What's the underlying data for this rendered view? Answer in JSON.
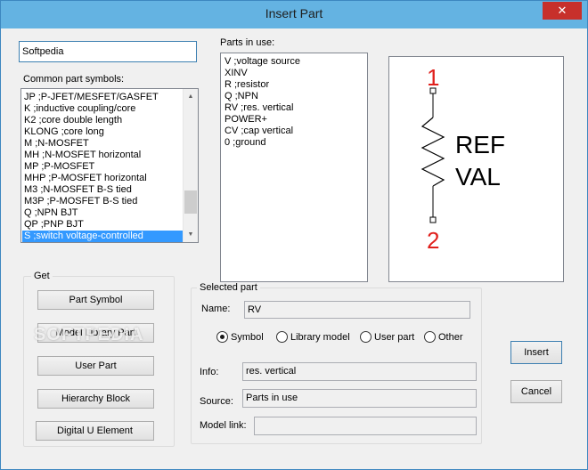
{
  "window": {
    "title": "Insert Part",
    "close_glyph": "✕"
  },
  "search_value": "Softpedia",
  "common_symbols": {
    "label": "Common part symbols:",
    "items": [
      "JP  ;P-JFET/MESFET/GASFET",
      "K  ;inductive coupling/core",
      "K2  ;core double length",
      "KLONG  ;core long",
      "M  ;N-MOSFET",
      "MH  ;N-MOSFET horizontal",
      "MP  ;P-MOSFET",
      "MHP  ;P-MOSFET horizontal",
      "M3  ;N-MOSFET B-S tied",
      "M3P  ;P-MOSFET B-S tied",
      "Q  ;NPN BJT",
      "QP  ;PNP BJT",
      "S  ;switch voltage-controlled"
    ],
    "selected_index": 12
  },
  "parts_in_use": {
    "label": "Parts in use:",
    "items": [
      "V  ;voltage source",
      "XINV",
      "R  ;resistor",
      "Q  ;NPN",
      "RV  ;res. vertical",
      "POWER+",
      "CV  ;cap vertical",
      "0  ;ground"
    ]
  },
  "preview": {
    "pin1": "1",
    "pin2": "2",
    "ref_text": "REF",
    "val_text": "VAL",
    "pin_color": "#e0201c"
  },
  "get_group": {
    "title": "Get",
    "buttons": [
      "Part Symbol",
      "Model Library Part",
      "User Part",
      "Hierarchy Block",
      "Digital U Element"
    ]
  },
  "selected_part": {
    "title": "Selected part",
    "name_label": "Name:",
    "name_value": "RV",
    "radios": [
      "Symbol",
      "Library model",
      "User part",
      "Other"
    ],
    "checked_radio": 0,
    "info_label": "Info:",
    "info_value": "res. vertical",
    "source_label": "Source:",
    "source_value": "Parts in use",
    "model_link_label": "Model link:",
    "model_link_value": ""
  },
  "actions": {
    "insert": "Insert",
    "cancel": "Cancel"
  },
  "watermark": "SOFTPEDIA"
}
